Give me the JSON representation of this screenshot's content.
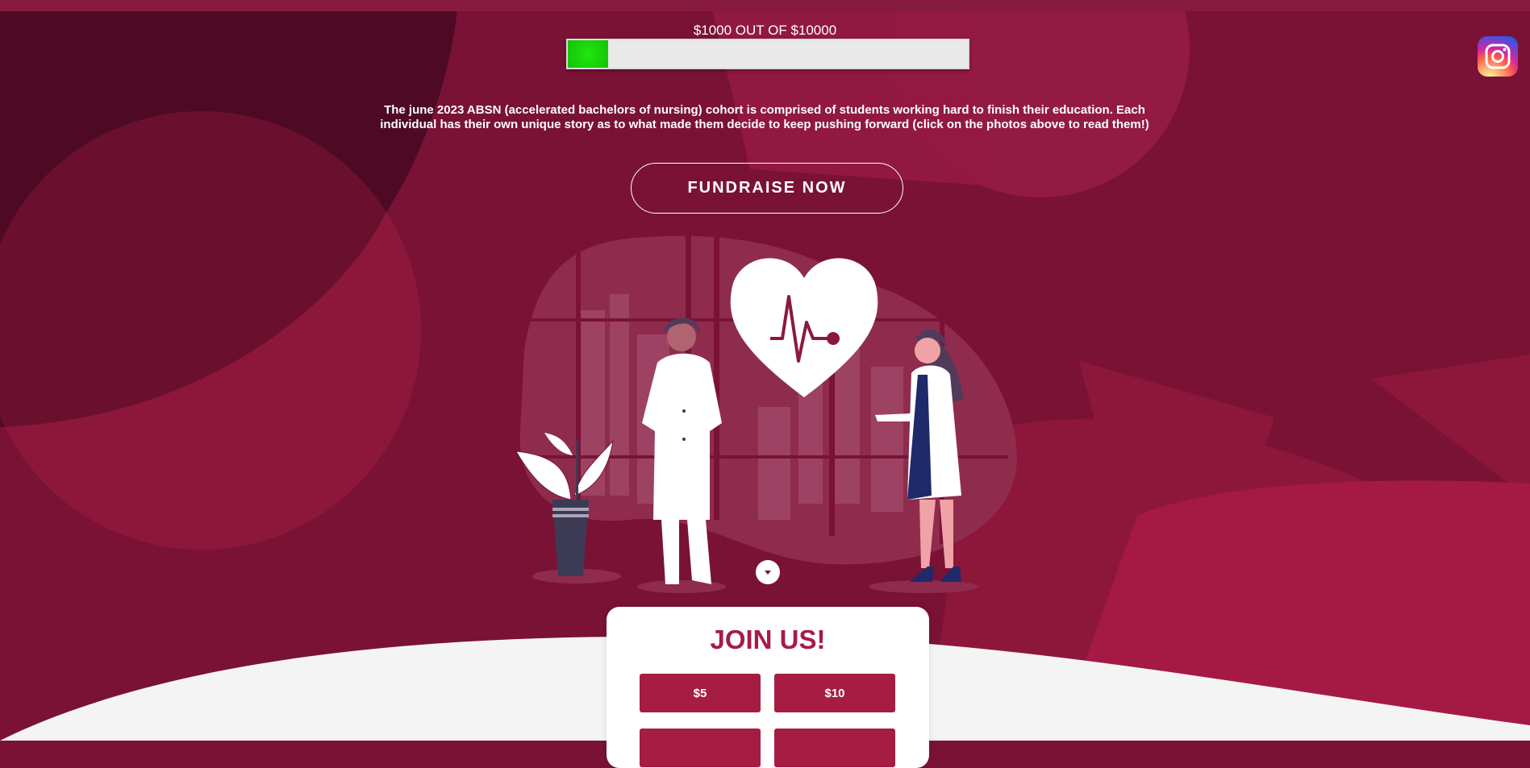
{
  "progress": {
    "label": "$1000 OUT OF $10000",
    "raised": 1000,
    "goal": 10000,
    "fill_fraction": 0.1,
    "fill_color": "#22dd12"
  },
  "social": {
    "icon": "instagram-icon"
  },
  "description": "The june 2023 ABSN (accelerated bachelors of nursing) cohort is comprised of students working hard to finish their education. Each individual has their own unique story as to what made them decide to keep pushing forward (click on the photos above to read them!)",
  "cta": {
    "fundraise_label": "FUNDRAISE NOW"
  },
  "hero": {
    "illustration": "doctors-with-heart-illustration",
    "scroll_icon": "chevron-down-icon"
  },
  "join": {
    "title": "JOIN US!",
    "amounts": [
      "$5",
      "$10",
      "",
      ""
    ]
  },
  "colors": {
    "background": "#7a1235",
    "accent": "#a61c45",
    "button": "#a61c42",
    "white": "#ffffff"
  }
}
